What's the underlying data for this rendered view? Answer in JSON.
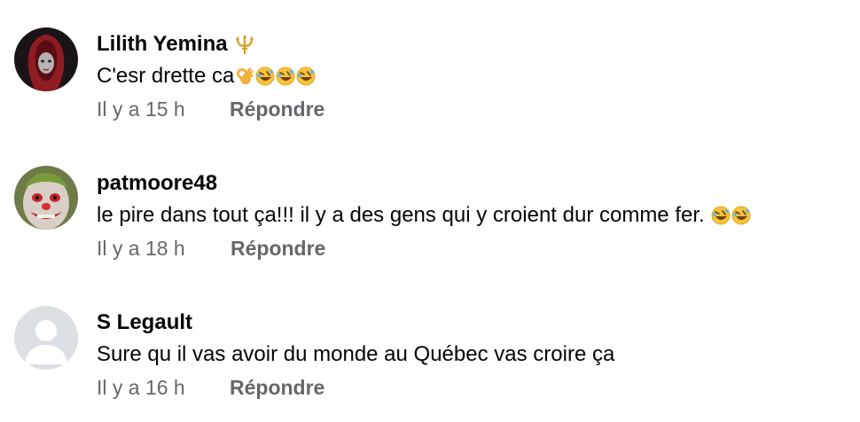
{
  "comments": [
    {
      "author": "Lilith Yemina",
      "badge_icon": "trident-icon",
      "text": "C'esr drette ca",
      "emojis": [
        "ok-hand-icon",
        "rofl-icon",
        "rofl-icon",
        "rofl-icon"
      ],
      "time": "Il y a 15 h",
      "reply_label": "Répondre"
    },
    {
      "author": "patmoore48",
      "text": "le pire dans tout ça!!! il y a des gens qui y croient dur comme fer. ",
      "emojis": [
        "rofl-icon",
        "rofl-icon"
      ],
      "time": "Il y a 18 h",
      "reply_label": "Répondre"
    },
    {
      "author": "S Legault",
      "text": "Sure qu il vas avoir du monde au Québec vas croire ça",
      "emojis": [],
      "time": "Il y a 16 h",
      "reply_label": "Répondre"
    }
  ],
  "colors": {
    "text": "#050505",
    "secondary": "#65676b",
    "default_avatar_bg": "#dcdfe4",
    "emoji_yellow": "#f7c33a"
  }
}
